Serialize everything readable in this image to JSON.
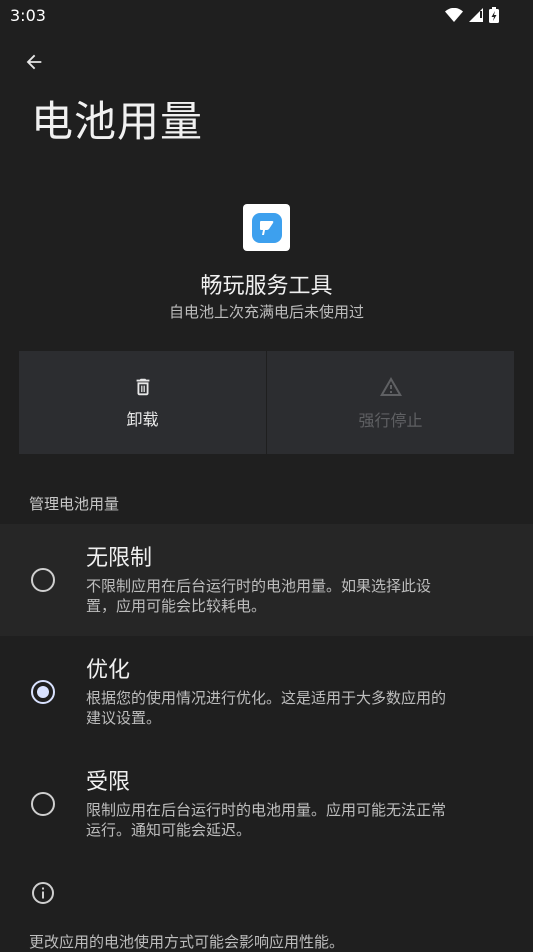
{
  "status_bar": {
    "time": "3:03",
    "icons": [
      "wifi-icon",
      "signal-icon",
      "battery-charging-icon"
    ]
  },
  "header": {
    "back_icon": "arrow-left-icon",
    "title": "电池用量"
  },
  "app": {
    "icon": "app-icon",
    "name": "畅玩服务工具",
    "summary": "自电池上次充满电后未使用过"
  },
  "actions": [
    {
      "label": "卸载",
      "icon": "trash-icon",
      "enabled": true
    },
    {
      "label": "强行停止",
      "icon": "warning-icon",
      "enabled": false
    }
  ],
  "section": {
    "title": "管理电池用量"
  },
  "options": [
    {
      "title": "无限制",
      "desc_line1": "不限制应用在后台运行时的电池用量。如果选择此设",
      "desc_line2": "置，应用可能会比较耗电。",
      "checked": false
    },
    {
      "title": "优化",
      "desc_line1": "根据您的使用情况进行优化。这是适用于大多数应用的",
      "desc_line2": "建议设置。",
      "checked": true
    },
    {
      "title": "受限",
      "desc_line1": "限制应用在后台运行时的电池用量。应用可能无法正常",
      "desc_line2": "运行。通知可能会延迟。",
      "checked": false
    }
  ],
  "footer": {
    "icon": "info-icon",
    "text": "更改应用的电池使用方式可能会影响应用性能。"
  },
  "colors": {
    "background": "#1f1f1f",
    "surface": "#2c2d30",
    "accent": "#d9e2ff",
    "app_icon_blue": "#3da0ee"
  }
}
